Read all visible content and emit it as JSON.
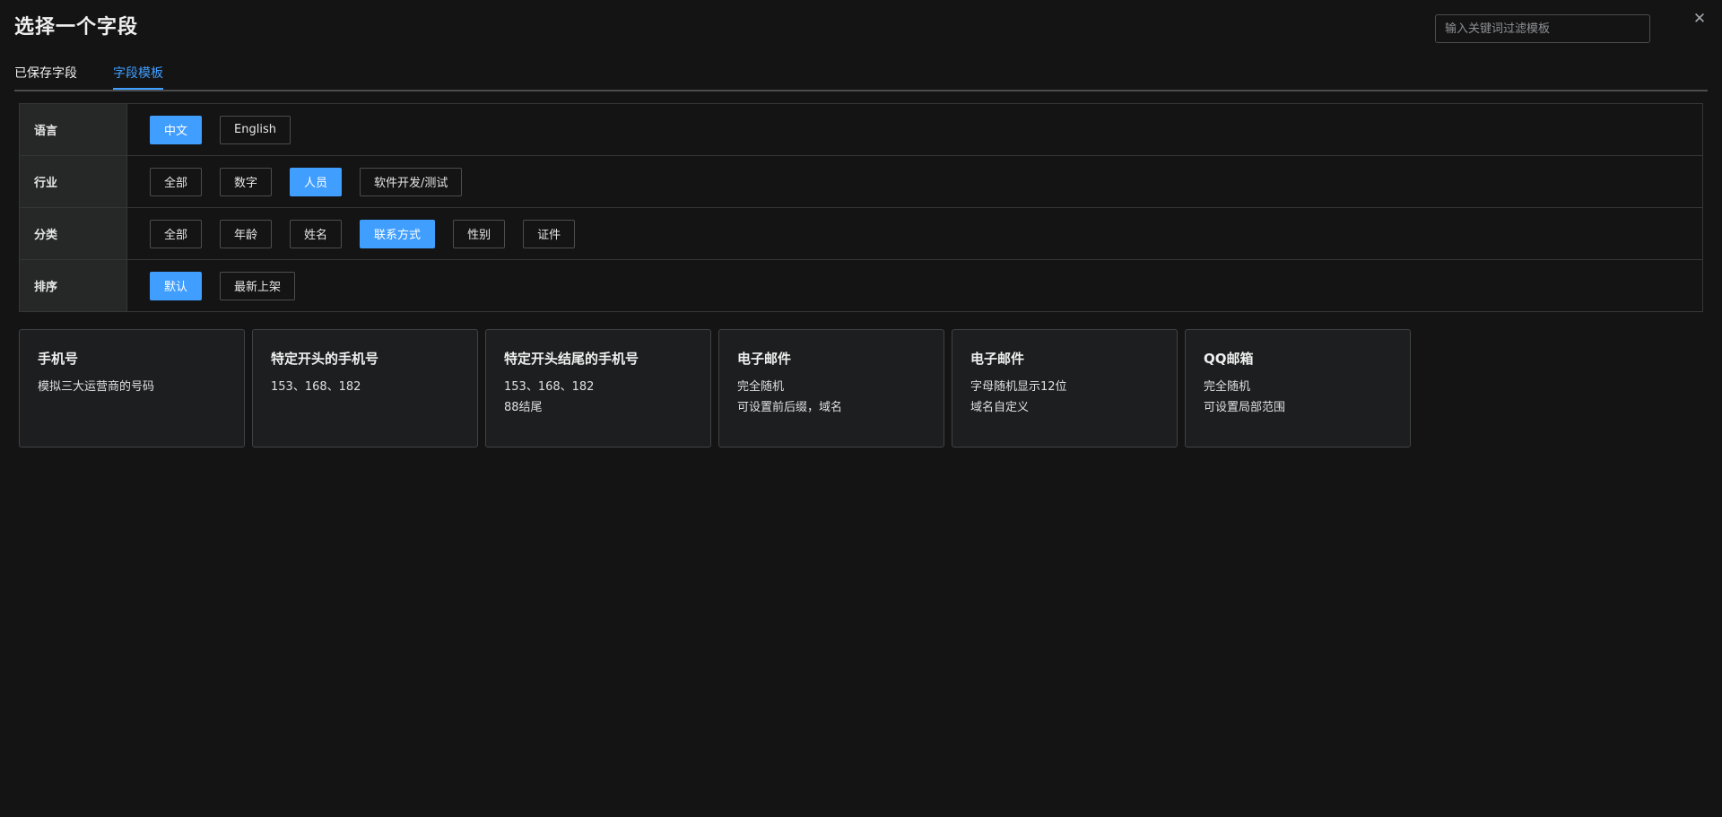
{
  "dialog": {
    "title": "选择一个字段",
    "search_placeholder": "输入关键词过滤模板",
    "close_glyph": "✕"
  },
  "tabs": [
    {
      "label": "已保存字段",
      "active": false
    },
    {
      "label": "字段模板",
      "active": true
    }
  ],
  "filters": {
    "language": {
      "label": "语言",
      "options": [
        {
          "label": "中文",
          "active": true
        },
        {
          "label": "English",
          "active": false
        }
      ]
    },
    "industry": {
      "label": "行业",
      "options": [
        {
          "label": "全部",
          "active": false
        },
        {
          "label": "数字",
          "active": false
        },
        {
          "label": "人员",
          "active": true
        },
        {
          "label": "软件开发/测试",
          "active": false
        }
      ]
    },
    "category": {
      "label": "分类",
      "options": [
        {
          "label": "全部",
          "active": false
        },
        {
          "label": "年龄",
          "active": false
        },
        {
          "label": "姓名",
          "active": false
        },
        {
          "label": "联系方式",
          "active": true
        },
        {
          "label": "性别",
          "active": false
        },
        {
          "label": "证件",
          "active": false
        }
      ]
    },
    "sort": {
      "label": "排序",
      "options": [
        {
          "label": "默认",
          "active": true
        },
        {
          "label": "最新上架",
          "active": false
        }
      ]
    }
  },
  "templates": [
    {
      "title": "手机号",
      "lines": [
        "模拟三大运营商的号码"
      ]
    },
    {
      "title": "特定开头的手机号",
      "lines": [
        "153、168、182"
      ]
    },
    {
      "title": "特定开头结尾的手机号",
      "lines": [
        "153、168、182",
        "88结尾"
      ]
    },
    {
      "title": "电子邮件",
      "lines": [
        "完全随机",
        "可设置前后缀，域名"
      ]
    },
    {
      "title": "电子邮件",
      "lines": [
        "字母随机显示12位",
        "域名自定义"
      ]
    },
    {
      "title": "QQ邮箱",
      "lines": [
        "完全随机",
        "可设置局部范围"
      ]
    }
  ],
  "colors": {
    "accent": "#409eff",
    "background": "#141414",
    "card_background": "#1d1e1f"
  }
}
